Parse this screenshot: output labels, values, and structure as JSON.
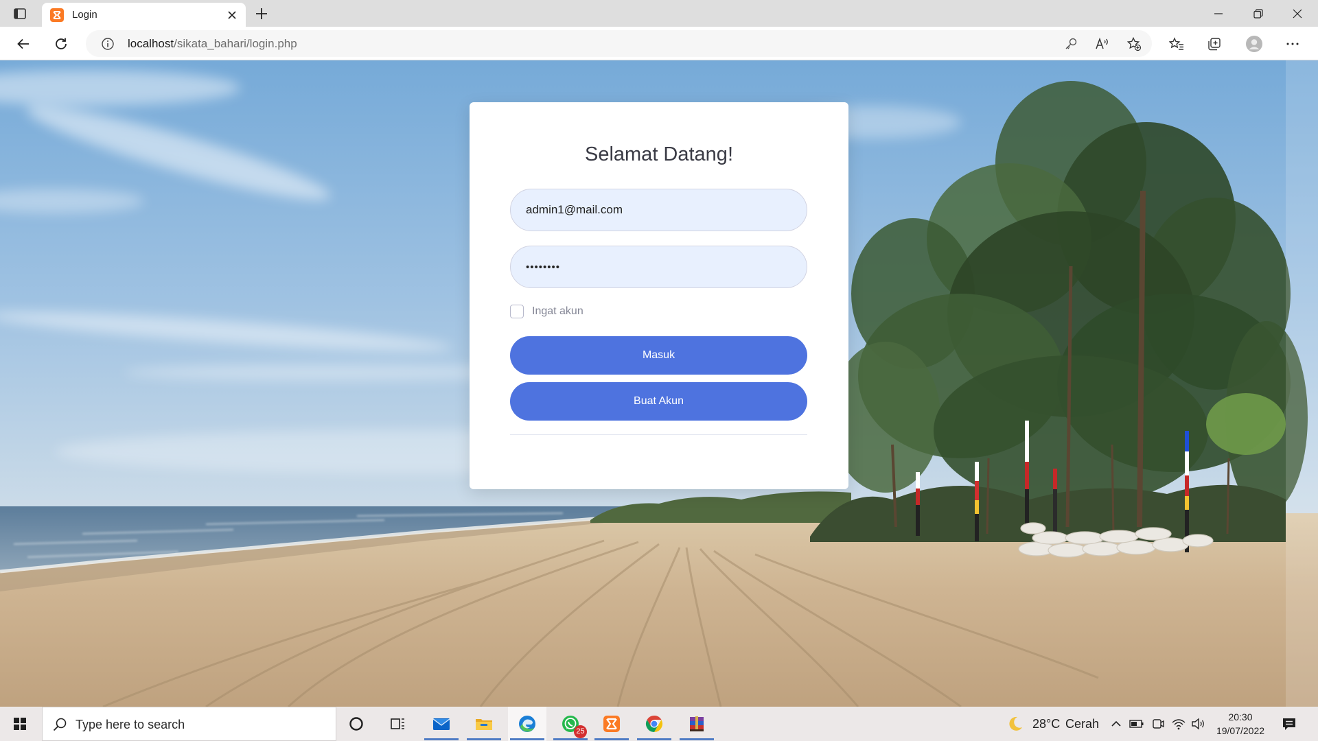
{
  "browser": {
    "tab": {
      "title": "Login",
      "favicon": "xampp-icon"
    },
    "address": {
      "host": "localhost",
      "path": "/sikata_bahari/login.php"
    },
    "toolbar_icons": [
      "back-icon",
      "refresh-icon",
      "info-icon",
      "key-icon",
      "read-aloud-icon",
      "add-favorite-icon",
      "favorites-icon",
      "collections-icon",
      "profile-icon",
      "more-icon"
    ]
  },
  "login": {
    "title": "Selamat Datang!",
    "email": "admin1@mail.com",
    "password": "••••••••",
    "remember_label": "Ingat akun",
    "remember_checked": false,
    "submit_label": "Masuk",
    "register_label": "Buat Akun"
  },
  "taskbar": {
    "search_placeholder": "Type here to search",
    "pinned": [
      "cortana-icon",
      "task-view-icon",
      "mail-icon",
      "file-explorer-icon",
      "edge-icon",
      "whatsapp-icon",
      "xampp-icon",
      "chrome-icon",
      "winrar-icon"
    ],
    "whatsapp_badge": "25",
    "weather": {
      "temp": "28°C",
      "condition": "Cerah"
    },
    "clock": {
      "time": "20:30",
      "date": "19/07/2022"
    }
  },
  "colors": {
    "accent": "#4e73df",
    "input_bg": "#e8f0fe",
    "card_bg": "#ffffff",
    "title": "#3a3b45",
    "muted": "#858796"
  }
}
